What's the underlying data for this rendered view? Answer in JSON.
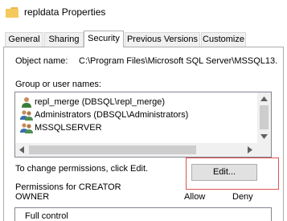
{
  "window": {
    "title": "repldata Properties",
    "icon": "folder-icon"
  },
  "tabs": [
    {
      "label": "General"
    },
    {
      "label": "Sharing"
    },
    {
      "label": "Security",
      "active": true
    },
    {
      "label": "Previous Versions"
    },
    {
      "label": "Customize"
    }
  ],
  "object": {
    "label": "Object name:",
    "value": "C:\\Program Files\\Microsoft SQL Server\\MSSQL13."
  },
  "groups": {
    "label": "Group or user names:",
    "items": [
      {
        "name": "repl_merge (DBSQL\\repl_merge)",
        "icon": "user-icon"
      },
      {
        "name": "Administrators (DBSQL\\Administrators)",
        "icon": "group-icon"
      },
      {
        "name": "MSSQLSERVER",
        "icon": "group-icon"
      }
    ]
  },
  "change_text": "To change permissions, click Edit.",
  "edit_button": "Edit...",
  "permissions": {
    "title_line1": "Permissions for CREATOR",
    "title_line2": "OWNER",
    "allow": "Allow",
    "deny": "Deny",
    "first_row": "Full control"
  },
  "colors": {
    "highlight": "#d9534f",
    "tab_active_bg": "#ffffff",
    "button_bg": "#e1e1e1"
  }
}
